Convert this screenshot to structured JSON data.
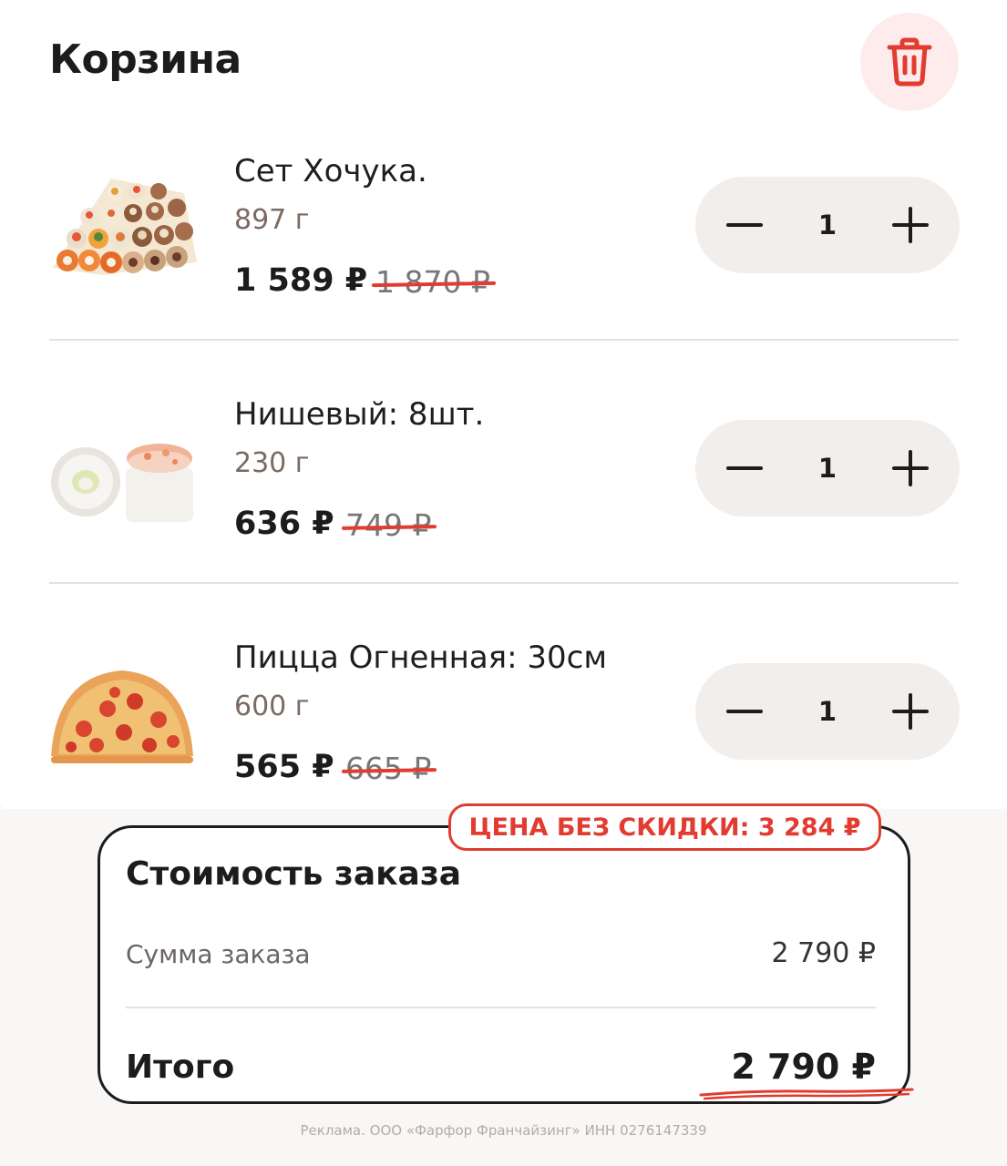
{
  "header": {
    "title": "Корзина",
    "trash_icon": "trash-icon"
  },
  "cart": {
    "items": [
      {
        "name": "Сет Хочука.",
        "weight": "897 г",
        "price": "1 589 ₽",
        "old_price": "1 870 ₽",
        "quantity": "1",
        "image": "sushi-set-image"
      },
      {
        "name": "Нишевый: 8шт.",
        "weight": "230 г",
        "price": "636 ₽",
        "old_price": "749 ₽",
        "quantity": "1",
        "image": "roll-image"
      },
      {
        "name": "Пицца Огненная: 30см",
        "weight": "600 г",
        "price": "565 ₽",
        "old_price": "665 ₽",
        "quantity": "1",
        "image": "pizza-image"
      }
    ]
  },
  "summary": {
    "badge": "ЦЕНА БЕЗ СКИДКИ: 3 284 ₽",
    "title": "Стоимость заказа",
    "subtotal_label": "Сумма заказа",
    "subtotal_value": "2 790 ₽",
    "total_label": "Итого",
    "total_value": "2 790 ₽"
  },
  "footer": {
    "ad": "Реклама. ООО «Фарфор Франчайзинг» ИНН 0276147339"
  },
  "colors": {
    "accent": "#e23b30",
    "trash_bg": "#fdeceb",
    "stepper_bg": "#f1eeec"
  }
}
